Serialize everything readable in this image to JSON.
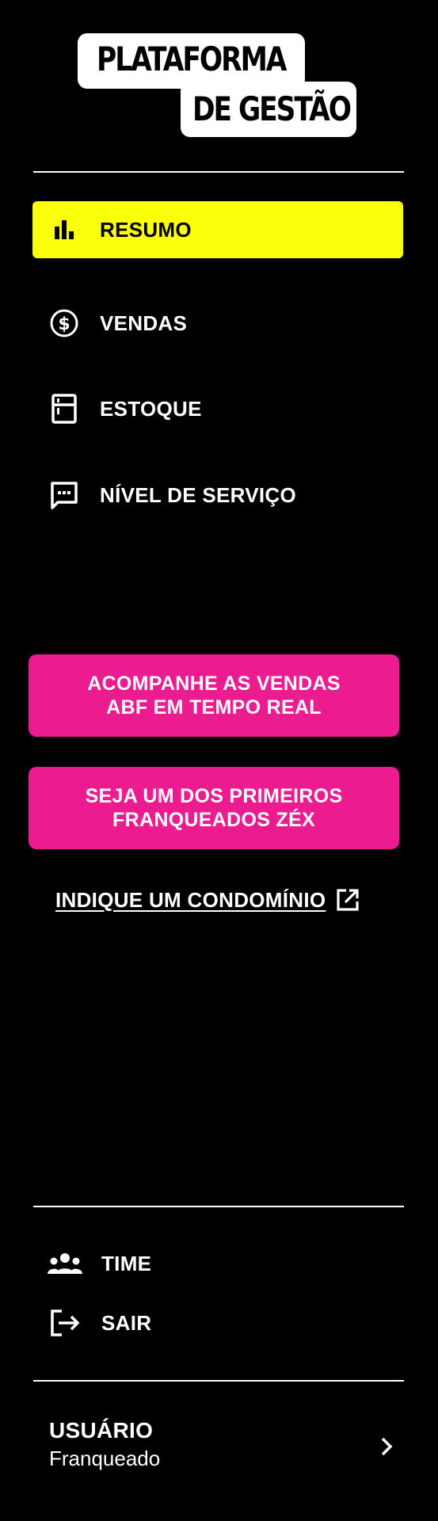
{
  "brand": {
    "line1": "PLATAFORMA",
    "line2": "DE GESTÃO"
  },
  "nav": {
    "items": [
      {
        "label": "RESUMO",
        "icon": "bar-chart-icon",
        "active": true
      },
      {
        "label": "VENDAS",
        "icon": "dollar-circle-icon",
        "active": false
      },
      {
        "label": "ESTOQUE",
        "icon": "fridge-icon",
        "active": false
      },
      {
        "label": "NÍVEL DE SERVIÇO",
        "icon": "chat-dots-icon",
        "active": false
      }
    ]
  },
  "cta": {
    "abf": {
      "line1": "ACOMPANHE AS VENDAS",
      "line2": "ABF EM TEMPO REAL"
    },
    "zex": {
      "line1": "SEJA UM DOS PRIMEIROS",
      "line2": "FRANQUEADOS ZÉX"
    }
  },
  "refer": {
    "label": "INDIQUE UM CONDOMÍNIO",
    "icon": "external-link-icon"
  },
  "footer": {
    "team": {
      "label": "TIME",
      "icon": "group-icon"
    },
    "logout": {
      "label": "SAIR",
      "icon": "logout-icon"
    }
  },
  "user": {
    "role": "USUÁRIO",
    "type": "Franqueado",
    "icon": "chevron-right-icon"
  },
  "colors": {
    "background": "#000000",
    "active": "#FAFF0A",
    "cta": "#EC1B8F",
    "text": "#FFFFFF"
  }
}
